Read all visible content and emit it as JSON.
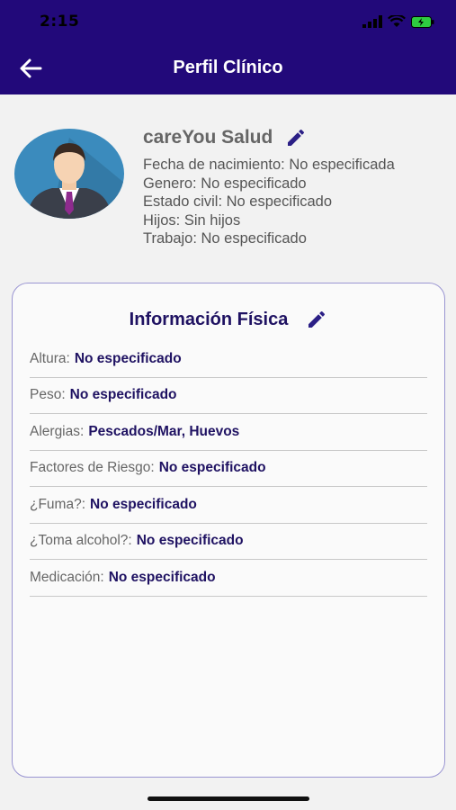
{
  "status_bar": {
    "time": "2:15"
  },
  "header": {
    "title": "Perfil Clínico",
    "back_icon": "arrow-left-icon"
  },
  "profile": {
    "name": "careYou Salud",
    "lines": [
      "Fecha de nacimiento: No especificada",
      "Genero: No especificado",
      "Estado civil:  No especificado",
      "Hijos: Sin  hijos",
      "Trabajo: No especificado"
    ]
  },
  "physical_info": {
    "title": "Información Física",
    "rows": [
      {
        "label": "Altura:",
        "value": "No especificado"
      },
      {
        "label": "Peso:",
        "value": "No especificado"
      },
      {
        "label": "Alergias:",
        "value": "Pescados/Mar, Huevos"
      },
      {
        "label": "Factores de Riesgo:",
        "value": "No especificado"
      },
      {
        "label": "¿Fuma?:",
        "value": "No especificado"
      },
      {
        "label": "¿Toma alcohol?:",
        "value": "No especificado"
      },
      {
        "label": "Medicación:",
        "value": "No especificado"
      }
    ]
  },
  "colors": {
    "primary": "#22097a",
    "text_accent": "#1f1262",
    "card_border": "#9a95d2"
  }
}
